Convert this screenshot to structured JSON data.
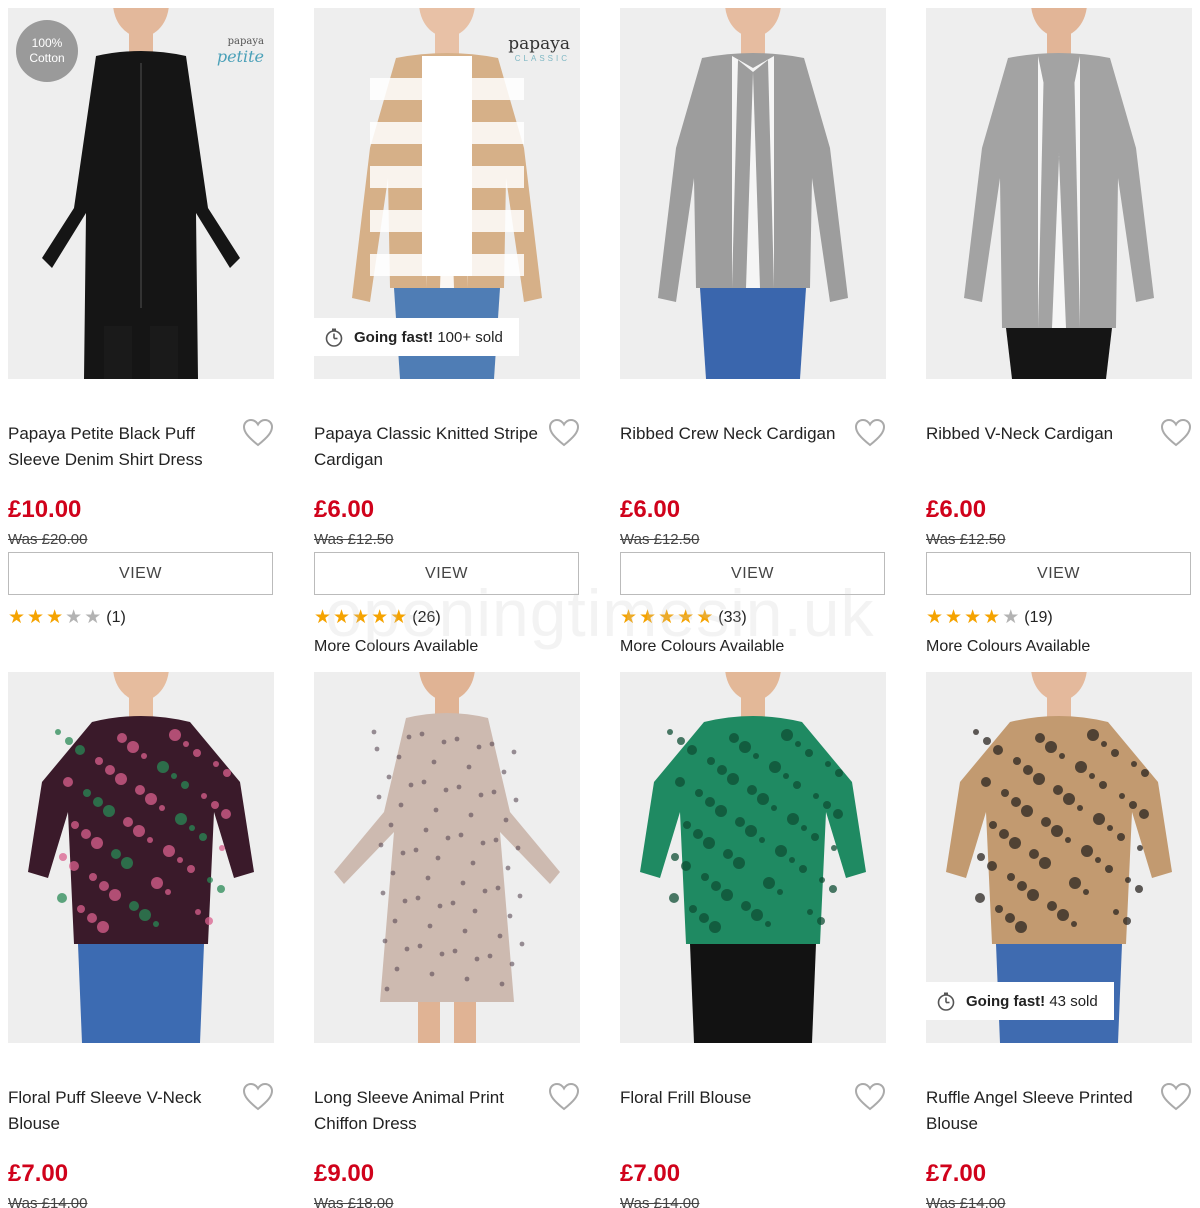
{
  "watermark": "openingtimesin.uk",
  "products": [
    {
      "title": "Papaya Petite Black Puff Sleeve Denim Shirt Dress",
      "price": "£10.00",
      "was": "Was £20.00",
      "button": "VIEW",
      "badge": [
        "100%",
        "Cotton"
      ],
      "logo": {
        "main": "papaya",
        "sub": "petite"
      },
      "rating": {
        "stars": 3,
        "count": "(1)"
      },
      "colours": "",
      "image": {
        "bg": "#eeeeee",
        "garment": "#151515",
        "skin": "#e3b89b",
        "legs": "#1a1a1a",
        "type": "dress"
      }
    },
    {
      "title": "Papaya Classic Knitted Stripe Cardigan",
      "price": "£6.00",
      "was": "Was £12.50",
      "button": "VIEW",
      "logo": {
        "main": "papaya",
        "sub": "CLASSIC"
      },
      "going_fast": {
        "label": "Going fast!",
        "detail": "100+ sold"
      },
      "rating": {
        "stars": 5,
        "count": "(26)"
      },
      "colours": "More Colours Available",
      "image": {
        "bg": "#eeeeee",
        "garment": "#d6b088",
        "skin": "#e8c1a6",
        "legs": "#4f7db5",
        "type": "cardigan-stripe"
      }
    },
    {
      "title": "Ribbed Crew Neck Cardigan",
      "price": "£6.00",
      "was": "Was £12.50",
      "button": "VIEW",
      "rating": {
        "stars": 5,
        "count": "(33)"
      },
      "colours": "More Colours Available",
      "image": {
        "bg": "#eeeeee",
        "garment": "#9d9d9d",
        "skin": "#e6bca0",
        "legs": "#3a66ad",
        "type": "cardigan"
      }
    },
    {
      "title": "Ribbed V-Neck Cardigan",
      "price": "£6.00",
      "was": "Was £12.50",
      "button": "VIEW",
      "rating": {
        "stars": 4,
        "count": "(19)"
      },
      "colours": "More Colours Available",
      "image": {
        "bg": "#eeeeee",
        "garment": "#a3a3a3",
        "skin": "#e2b597",
        "legs": "#151515",
        "type": "cardigan-long"
      }
    },
    {
      "title": "Floral Puff Sleeve V-Neck Blouse",
      "price": "£7.00",
      "was": "Was £14.00",
      "image": {
        "bg": "#eeeeee",
        "garment": "#3a1a2a",
        "accent": "#d9608e",
        "accent2": "#2a8a55",
        "skin": "#e6bc9e",
        "legs": "#3c6bb2",
        "type": "blouse"
      }
    },
    {
      "title": "Long Sleeve Animal Print Chiffon Dress",
      "price": "£9.00",
      "was": "Was £18.00",
      "image": {
        "bg": "#eeeeee",
        "garment": "#cdbab0",
        "accent": "#5a4a55",
        "skin": "#e0b394",
        "legs": "#e0b394",
        "type": "dress-light"
      }
    },
    {
      "title": "Floral Frill Blouse",
      "price": "£7.00",
      "was": "Was £14.00",
      "image": {
        "bg": "#eeeeee",
        "garment": "#1f8a62",
        "accent": "#0f4d34",
        "skin": "#e3b898",
        "legs": "#121212",
        "type": "blouse"
      }
    },
    {
      "title": "Ruffle Angel Sleeve Printed Blouse",
      "price": "£7.00",
      "was": "Was £14.00",
      "going_fast": {
        "label": "Going fast!",
        "detail": "43 sold"
      },
      "image": {
        "bg": "#eeeeee",
        "garment": "#c29a70",
        "accent": "#2a2420",
        "skin": "#e4b99c",
        "legs": "#3f6bb0",
        "type": "blouse"
      }
    }
  ]
}
